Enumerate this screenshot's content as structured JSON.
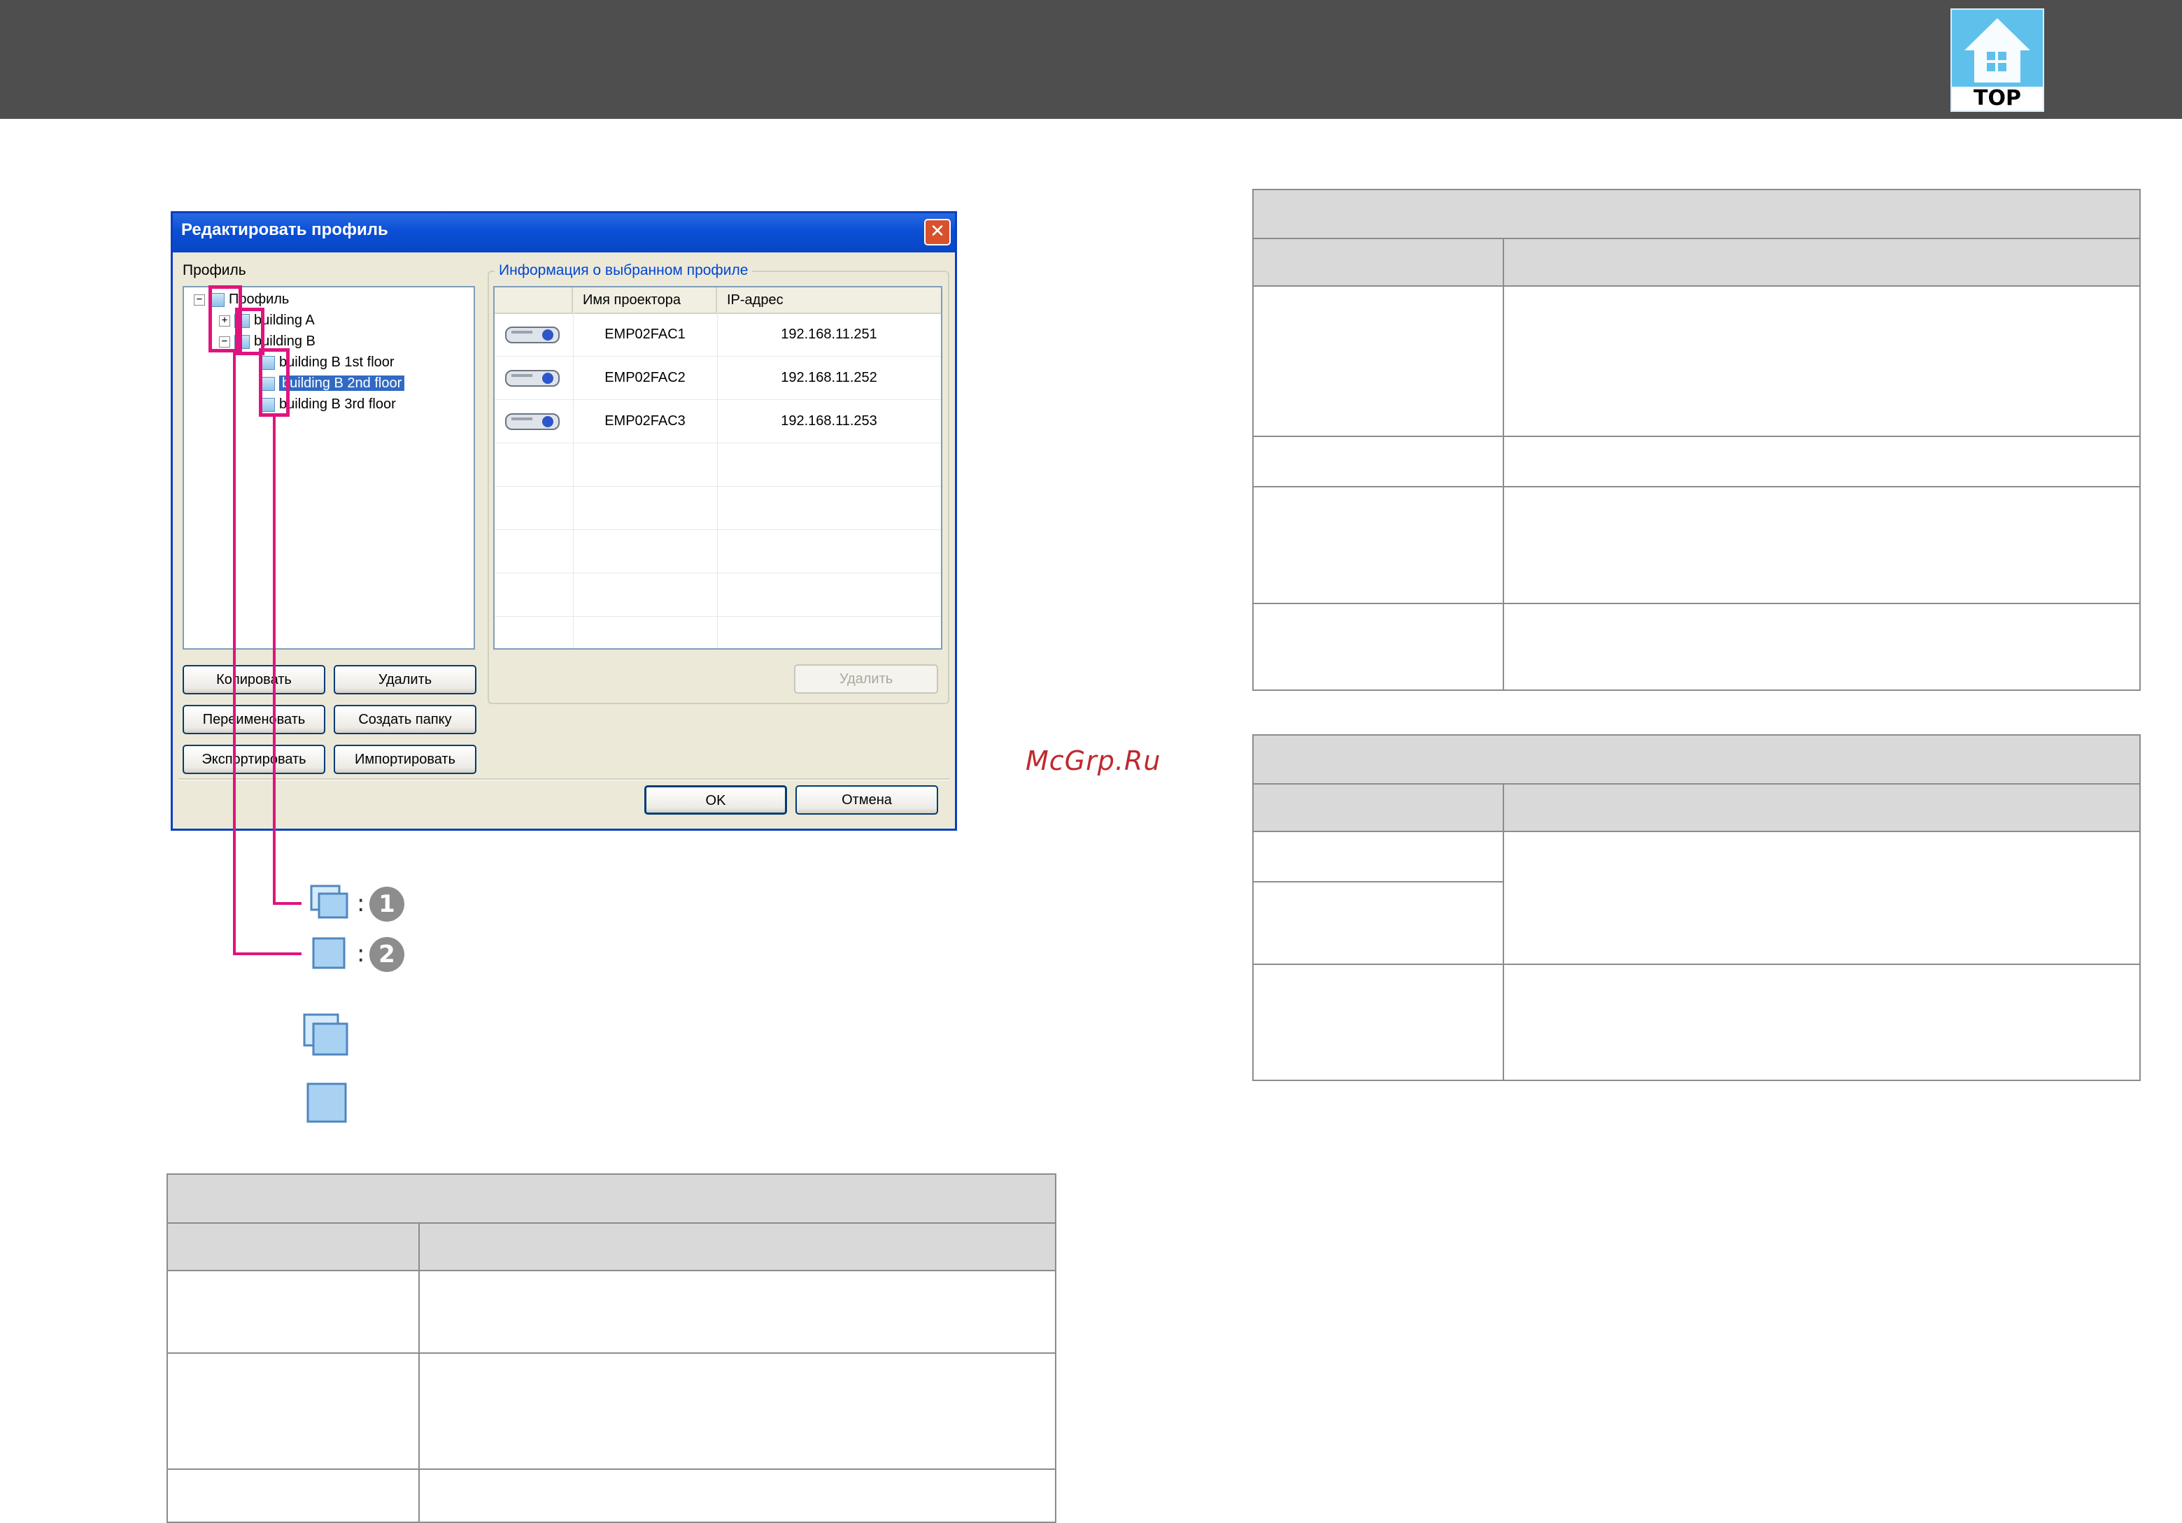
{
  "header": {
    "top_button_label": "TOP",
    "top_icon": "house-icon"
  },
  "dialog": {
    "title": "Редактировать профиль",
    "close_icon": "close-icon",
    "profile_label": "Профиль",
    "tree": {
      "root": "Профиль",
      "building_a": "building A",
      "building_b": "building B",
      "floor1": "building B 1st floor",
      "floor2": "building B 2nd floor",
      "floor3": "building B 3rd floor"
    },
    "info_group_title": "Информация о выбранном профиле",
    "columns": {
      "name": "Имя проектора",
      "ip": "IP-адрес"
    },
    "rows": [
      {
        "name": "EMP02FAC1",
        "ip": "192.168.11.251"
      },
      {
        "name": "EMP02FAC2",
        "ip": "192.168.11.252"
      },
      {
        "name": "EMP02FAC3",
        "ip": "192.168.11.253"
      }
    ],
    "buttons": {
      "copy": "Копировать",
      "delete": "Удалить",
      "rename": "Переименовать",
      "create_folder": "Создать папку",
      "export": "Экспортировать",
      "import": "Импортировать",
      "delete_list": "Удалить",
      "ok": "OK",
      "cancel": "Отмена"
    }
  },
  "callouts": {
    "colon": ":",
    "num1": "1",
    "num2": "2"
  },
  "watermark": "McGrp.Ru"
}
